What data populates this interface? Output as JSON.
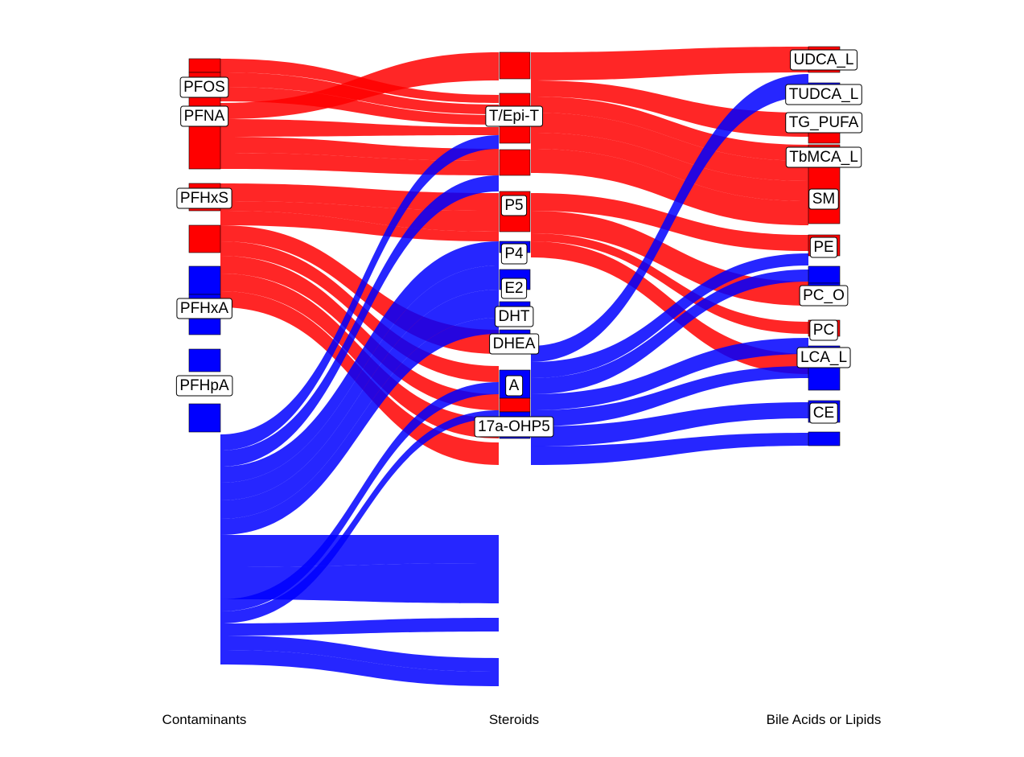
{
  "chart_data": {
    "type": "alluvial",
    "colors": {
      "positive": "#ff0000",
      "negative": "#0000ff"
    },
    "axes": [
      "Contaminants",
      "Steroids",
      "Bile Acids or Lipids"
    ],
    "nodes": {
      "Contaminants": [
        "PFOS",
        "PFNA",
        "PFHxS",
        "PFHxA",
        "PFHpA"
      ],
      "Steroids": [
        "T/Epi-T",
        "P5",
        "P4",
        "E2",
        "DHT",
        "DHEA",
        "A",
        "17a-OHP5"
      ],
      "Bile Acids or Lipids": [
        "UDCA_L",
        "TUDCA_L",
        "TG_PUFA",
        "TbMCA_L",
        "SM",
        "PE",
        "PC_O",
        "PC",
        "LCA_L",
        "CE"
      ]
    }
  }
}
